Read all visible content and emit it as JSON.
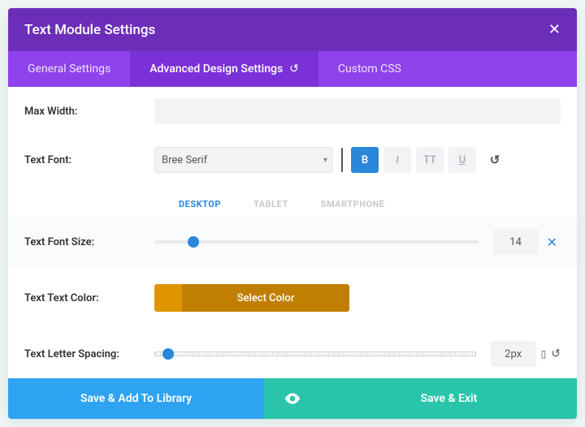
{
  "header": {
    "title": "Text Module Settings"
  },
  "tabs": {
    "general": "General Settings",
    "advanced": "Advanced Design Settings",
    "custom": "Custom CSS"
  },
  "labels": {
    "max_width": "Max Width:",
    "text_font": "Text Font:",
    "font_size": "Text Font Size:",
    "text_color": "Text Text Color:",
    "letter_spacing": "Text Letter Spacing:"
  },
  "font": {
    "selected": "Bree Serif",
    "bold": "B",
    "italic": "I",
    "caps": "TT",
    "underline": "U"
  },
  "devices": {
    "desktop": "DESKTOP",
    "tablet": "TABLET",
    "smartphone": "SMARTPHONE"
  },
  "font_size": {
    "value": "14"
  },
  "color": {
    "button_label": "Select Color"
  },
  "letter_spacing": {
    "value": "2px"
  },
  "footer": {
    "library": "Save & Add To Library",
    "save_exit": "Save & Exit"
  }
}
